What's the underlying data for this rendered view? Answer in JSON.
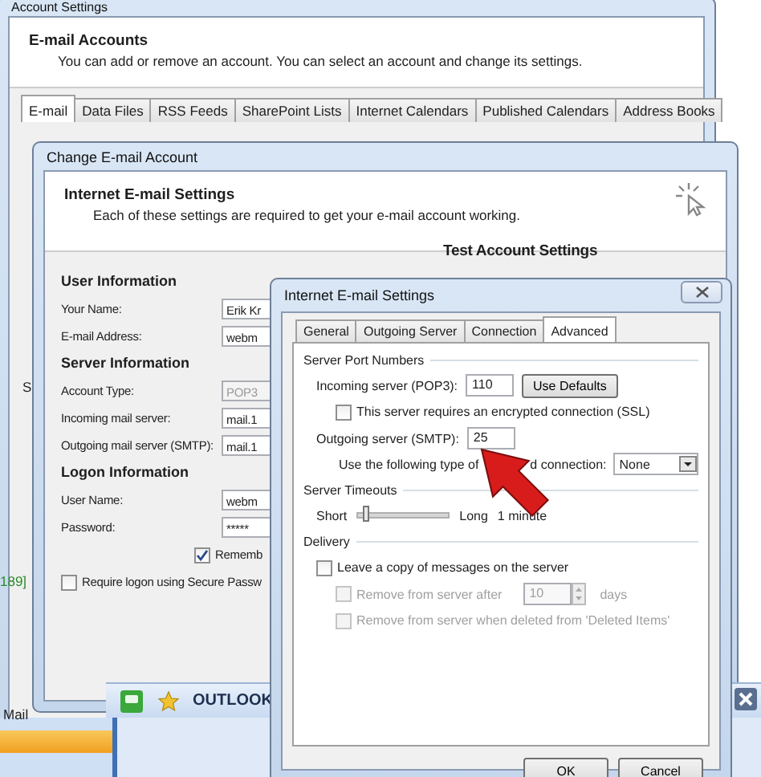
{
  "account_settings": {
    "title": "Account Settings",
    "heading": "E-mail Accounts",
    "description": "You can add or remove an account. You can select an account and change its settings.",
    "tabs": [
      {
        "label": "E-mail",
        "selected": true
      },
      {
        "label": "Data Files",
        "selected": false
      },
      {
        "label": "RSS Feeds",
        "selected": false
      },
      {
        "label": "SharePoint Lists",
        "selected": false
      },
      {
        "label": "Internet Calendars",
        "selected": false
      },
      {
        "label": "Published Calendars",
        "selected": false
      },
      {
        "label": "Address Books",
        "selected": false
      }
    ],
    "fragments": [
      "S",
      "189]",
      "Mail"
    ]
  },
  "change_account": {
    "title": "Change E-mail Account",
    "heading": "Internet E-mail Settings",
    "description": "Each of these settings are required to get your e-mail account working.",
    "test_heading": "Test Account Settings",
    "sections": [
      {
        "heading": "User Information",
        "fields": [
          {
            "label": "Your Name:",
            "value": "Erik Kr",
            "disabled": false
          },
          {
            "label": "E-mail Address:",
            "value": "webm",
            "disabled": false
          }
        ]
      },
      {
        "heading": "Server Information",
        "fields": [
          {
            "label": "Account Type:",
            "value": "POP3",
            "disabled": true
          },
          {
            "label": "Incoming mail server:",
            "value": "mail.1",
            "disabled": false
          },
          {
            "label": "Outgoing mail server (SMTP):",
            "value": "mail.1",
            "disabled": false
          }
        ]
      },
      {
        "heading": "Logon Information",
        "fields": [
          {
            "label": "User Name:",
            "value": "webm",
            "disabled": false
          },
          {
            "label": "Password:",
            "value": "*****",
            "disabled": false
          }
        ]
      }
    ],
    "remember": {
      "label": "Rememb",
      "checked": true
    },
    "spa": {
      "label": "Require logon using Secure Passw",
      "checked": false
    }
  },
  "outlook_bar": {
    "label": "OUTLOOK"
  },
  "email_settings": {
    "title": "Internet E-mail Settings",
    "tabs": [
      {
        "label": "General",
        "selected": false
      },
      {
        "label": "Outgoing Server",
        "selected": false
      },
      {
        "label": "Connection",
        "selected": false
      },
      {
        "label": "Advanced",
        "selected": true
      }
    ],
    "port_group": "Server Port Numbers",
    "incoming": {
      "label": "Incoming server (POP3):",
      "value": "110"
    },
    "defaults_button": "Use Defaults",
    "ssl": {
      "label": "This server requires an encrypted connection (SSL)",
      "checked": false,
      "disabled": false
    },
    "outgoing": {
      "label": "Outgoing server (SMTP):",
      "value": "25"
    },
    "encryption": {
      "label_before": "Use the following type of",
      "label_after": "d connection:",
      "value": "None"
    },
    "timeout_group": "Server Timeouts",
    "timeout": {
      "short": "Short",
      "long": "Long",
      "level": 0.05,
      "reading": "1 minute"
    },
    "delivery_group": "Delivery",
    "leave_copy": {
      "label": "Leave a copy of messages on the server",
      "checked": false,
      "disabled": false
    },
    "remove_after": {
      "label": "Remove from server after",
      "checked": false,
      "disabled": true,
      "value": "10",
      "unit": "days"
    },
    "remove_deleted": {
      "label": "Remove from server when deleted from 'Deleted Items'",
      "checked": false,
      "disabled": true
    },
    "buttons": [
      "OK",
      "Cancel"
    ]
  }
}
